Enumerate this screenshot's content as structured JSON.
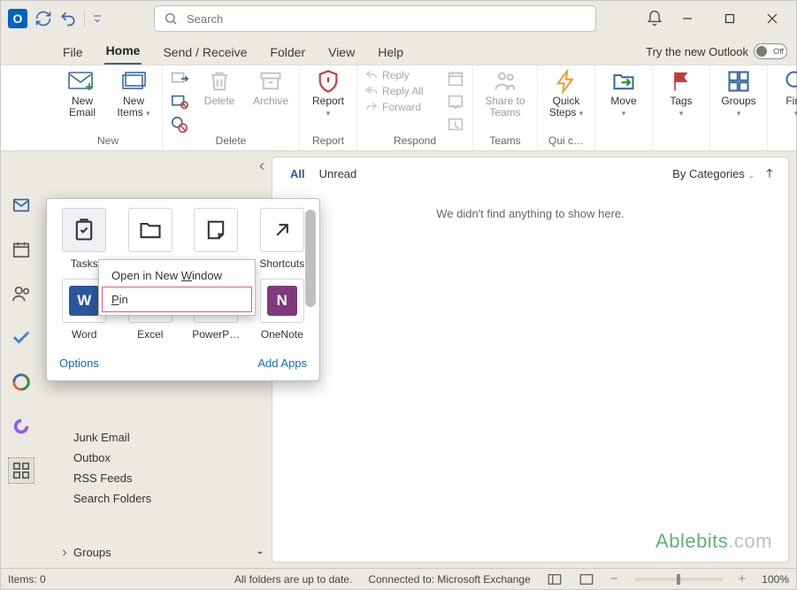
{
  "titlebar": {
    "search_placeholder": "Search"
  },
  "try_new": {
    "label": "Try the new Outlook",
    "state": "Off"
  },
  "tabs": {
    "file": "File",
    "home": "Home",
    "sendrecv": "Send / Receive",
    "folder": "Folder",
    "view": "View",
    "help": "Help"
  },
  "ribbon": {
    "new": {
      "email": "New Email",
      "items": "New Items",
      "group": "New"
    },
    "delete": {
      "delete": "Delete",
      "archive": "Archive",
      "group": "Delete"
    },
    "report": {
      "btn": "Report",
      "group": "Report"
    },
    "respond": {
      "reply": "Reply",
      "replyall": "Reply All",
      "forward": "Forward",
      "group": "Respond"
    },
    "teams": {
      "btn": "Share to Teams",
      "group": "Teams"
    },
    "quicksteps": {
      "btn": "Quick Steps",
      "group": "Qui c…"
    },
    "move": {
      "btn": "Move"
    },
    "tags": {
      "btn": "Tags"
    },
    "groups": {
      "btn": "Groups"
    },
    "find": {
      "btn": "Find"
    }
  },
  "reading": {
    "filter_all": "All",
    "filter_unread": "Unread",
    "sort": "By Categories",
    "empty": "We didn't find anything to show here."
  },
  "nav": {
    "items": [
      "Junk Email",
      "Outbox",
      "RSS Feeds",
      "Search Folders"
    ],
    "groups": "Groups"
  },
  "apps_popup": {
    "tiles": [
      "Tasks",
      "Folders",
      "Notes",
      "Shortcuts",
      "Word",
      "Excel",
      "PowerP…",
      "OneNote"
    ],
    "options": "Options",
    "add": "Add Apps",
    "ctx": {
      "open": "Open in New Window",
      "pin": "Pin",
      "open_mn": "W",
      "pin_mn": "P"
    }
  },
  "status": {
    "items": "Items: 0",
    "folders": "All folders are up to date.",
    "connected": "Connected to: Microsoft Exchange",
    "zoom": "100%"
  },
  "watermark": {
    "a": "Ablebits",
    "b": ".com"
  }
}
